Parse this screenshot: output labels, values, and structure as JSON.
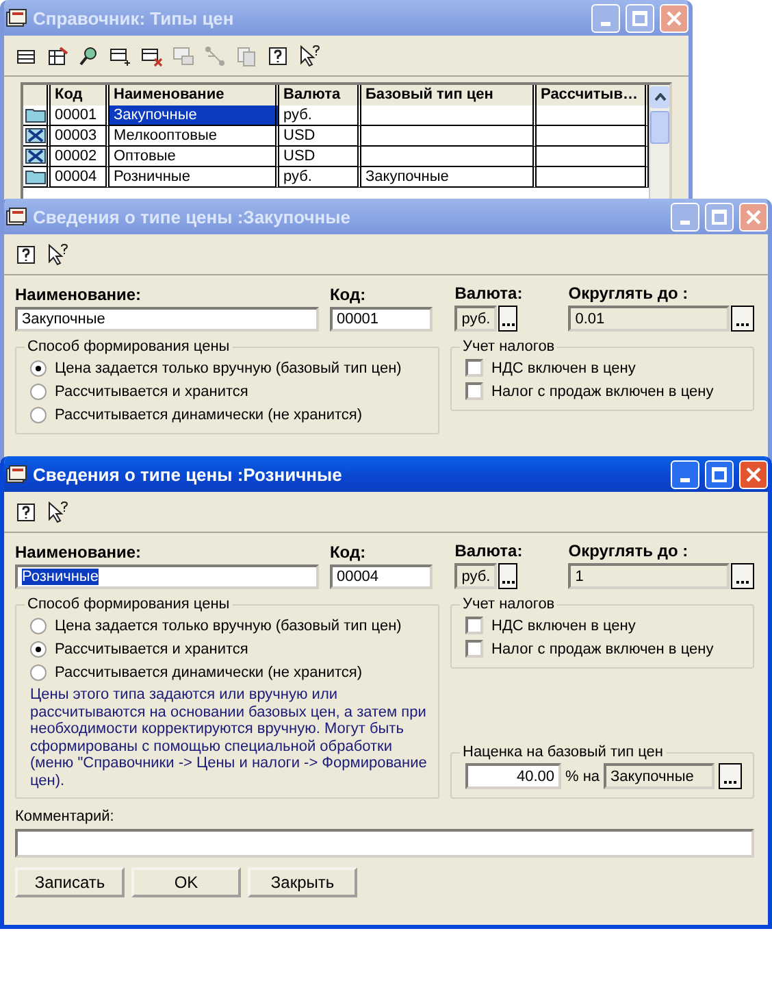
{
  "catalog_window": {
    "title": "Справочник: Типы цен",
    "active": false,
    "toolbar": [
      {
        "kind": "table",
        "disabled": false
      },
      {
        "kind": "table-edit",
        "disabled": false
      },
      {
        "kind": "search",
        "disabled": false
      },
      {
        "kind": "add-row",
        "disabled": false
      },
      {
        "kind": "delete-row",
        "disabled": false
      },
      {
        "kind": "save",
        "disabled": true
      },
      {
        "kind": "hierarchy",
        "disabled": true
      },
      {
        "kind": "copy",
        "disabled": true
      },
      {
        "kind": "help",
        "disabled": false
      },
      {
        "kind": "pointer-help",
        "disabled": false
      }
    ],
    "table": {
      "columns": [
        "Код",
        "Наименование",
        "Валюта",
        "Базовый тип цен",
        "Рассчитыв…"
      ],
      "rows": [
        {
          "kind": "folder",
          "code": "00001",
          "name": "Закупочные",
          "currency": "руб.",
          "selected": true
        },
        {
          "kind": "deleted",
          "code": "00003",
          "name": "Мелкооптовые",
          "currency": "USD",
          "selected": false
        },
        {
          "kind": "deleted",
          "code": "00002",
          "name": "Оптовые",
          "currency": "USD",
          "selected": false
        },
        {
          "kind": "folder",
          "code": "00004",
          "name": "Розничные",
          "currency": "руб.",
          "base_type": "Закупочные",
          "selected": false
        }
      ]
    }
  },
  "form_windows": [
    {
      "title": "Сведения о типе цены :Закупочные",
      "active": false,
      "toolbar": [
        {
          "kind": "help"
        },
        {
          "kind": "pointer-help"
        }
      ],
      "name_label": "Наименование:",
      "name": "Закупочные",
      "name_selected": false,
      "code_label": "Код:",
      "code": "00001",
      "currency_label": "Валюта:",
      "currency": "руб.",
      "round_label": "Округлять до :",
      "round_to": "0.01",
      "method_group": {
        "title": "Способ формирования цены",
        "options": [
          {
            "label": "Цена задается только вручную (базовый тип цен)",
            "selected": true
          },
          {
            "label": "Рассчитывается и хранится",
            "selected": false
          },
          {
            "label": "Рассчитывается динамически (не хранится)",
            "selected": false
          }
        ]
      },
      "tax_group": {
        "title": "Учет налогов",
        "options": [
          {
            "label": "НДС включен в цену",
            "checked": false
          },
          {
            "label": "Налог с продаж включен в цену",
            "checked": false
          }
        ]
      }
    },
    {
      "title": "Сведения о типе цены :Розничные",
      "active": true,
      "toolbar": [
        {
          "kind": "help"
        },
        {
          "kind": "pointer-help"
        }
      ],
      "name_label": "Наименование:",
      "name": "Розничные",
      "name_selected": true,
      "code_label": "Код:",
      "code": "00004",
      "currency_label": "Валюта:",
      "currency": "руб.",
      "round_label": "Округлять до :",
      "round_to": "1",
      "method_group": {
        "title": "Способ формирования цены",
        "options": [
          {
            "label": "Цена задается только вручную (базовый тип цен)",
            "selected": false
          },
          {
            "label": "Рассчитывается и хранится",
            "selected": true
          },
          {
            "label": "Рассчитывается динамически (не хранится)",
            "selected": false
          }
        ],
        "note": "Цены этого типа задаются или вручную или рассчитываются на основании базовых цен, а затем при необходимости корректируются вручную. Могут быть сформированы с помощью специальной обработки (меню \"Справочники -> Цены и налоги -> Формирование цен)."
      },
      "tax_group": {
        "title": "Учет налогов",
        "options": [
          {
            "label": "НДС включен в цену",
            "checked": false
          },
          {
            "label": "Налог с продаж включен в цену",
            "checked": false
          }
        ]
      },
      "markup_group": {
        "title": "Наценка на базовый тип цен",
        "value": "40.00",
        "unit": "% на",
        "base": "Закупочные"
      },
      "comment_label": "Комментарий:",
      "buttons": [
        "Записать",
        "OK",
        "Закрыть"
      ]
    }
  ]
}
